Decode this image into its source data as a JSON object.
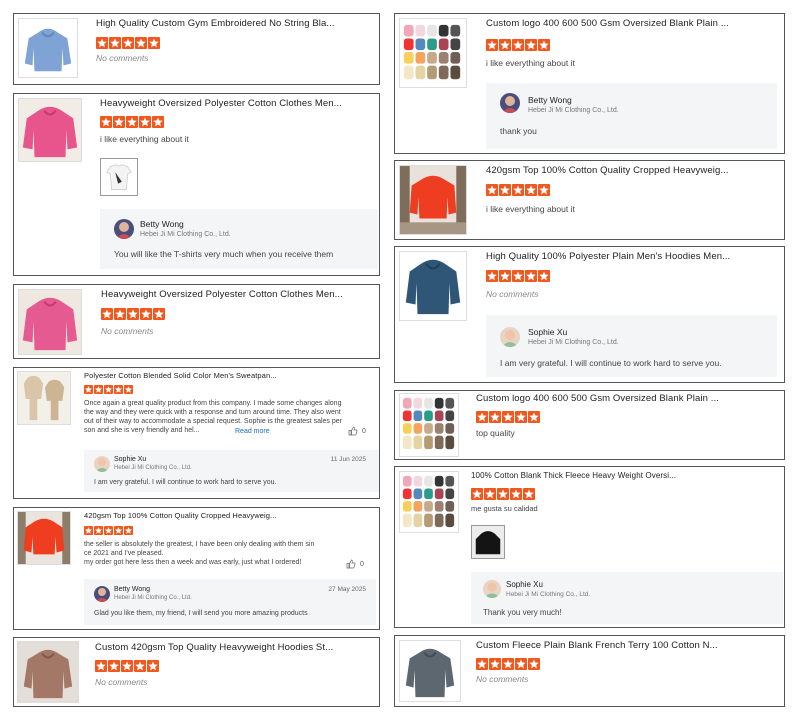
{
  "colors": {
    "star": "#f2581d",
    "reply_bg": "#f4f5f7",
    "link": "#1a6ec2"
  },
  "reviews": [
    {
      "title": "High Quality Custom Gym Embroidered No String Bla...",
      "comment": "No comments"
    },
    {
      "title": "Heavyweight Oversized Polyester Cotton Clothes Men...",
      "comment": "i like everything about it",
      "reply": {
        "name": "Betty Wong",
        "company": "Hebei Ji Mi Clothing Co., Ltd.",
        "text": "You will like the T-shirts very much when you receive them"
      }
    },
    {
      "title": "Heavyweight Oversized Polyester Cotton Clothes Men...",
      "comment": "No comments"
    },
    {
      "title": "Polyester Cotton Blended Solid Color Men's Sweatpan...",
      "comment": "Once again a great quality product from this company. I made some changes along the way and they were quick with a response and turn around time. They also went out of their way to accommodate a special request. Sophie is the greatest sales per son and she is very friendly and hel...",
      "read_more": "Read more",
      "likes": "0",
      "reply": {
        "name": "Sophie Xu",
        "company": "Hebei Ji Mi Clothing Co., Ltd.",
        "date": "11 Jun 2025",
        "text": "I am very grateful. I will continue to work hard to serve you."
      }
    },
    {
      "title": "420gsm Top 100% Cotton Quality Cropped Heavyweig...",
      "comment_lines": [
        "the seller is absolutely the greatest, I have been only dealing with them sin",
        "ce 2021 and I've pleased.",
        "my order got here less then a week and was early, just what I ordered!"
      ],
      "likes": "0",
      "reply": {
        "name": "Betty Wong",
        "company": "Hebei Ji Mi Clothing Co., Ltd.",
        "date": "27 May 2025",
        "text": "Glad you like them, my friend, I will send you more amazing products"
      }
    },
    {
      "title": "Custom 420gsm Top Quality Heavyweight Hoodies St...",
      "comment": "No comments"
    },
    {
      "title": "Custom logo 400 600 500 Gsm Oversized Blank Plain ...",
      "comment": "i like everything about it",
      "reply": {
        "name": "Betty Wong",
        "company": "Hebei Ji Mi Clothing Co., Ltd.",
        "text": "thank you"
      }
    },
    {
      "title": "420gsm Top 100% Cotton Quality Cropped Heavyweig...",
      "comment": "i like everything about it"
    },
    {
      "title": "High Quality 100% Polyester Plain Men's Hoodies Men...",
      "comment": "No comments",
      "reply": {
        "name": "Sophie Xu",
        "company": "Hebei Ji Mi Clothing Co., Ltd.",
        "text": "I am very grateful. I will continue to work hard to serve you."
      }
    },
    {
      "title": "Custom logo 400 600 500 Gsm Oversized Blank Plain ...",
      "comment": "top quality"
    },
    {
      "title": "100% Cotton Blank Thick Fleece Heavy Weight Oversi...",
      "comment": "me gusta su calidad",
      "reply": {
        "name": "Sophie Xu",
        "company": "Hebei Ji Mi Clothing Co., Ltd.",
        "text": "Thank you very much!"
      }
    },
    {
      "title": "Custom Fleece Plain Blank French Terry 100 Cotton N...",
      "comment": "No comments"
    }
  ]
}
